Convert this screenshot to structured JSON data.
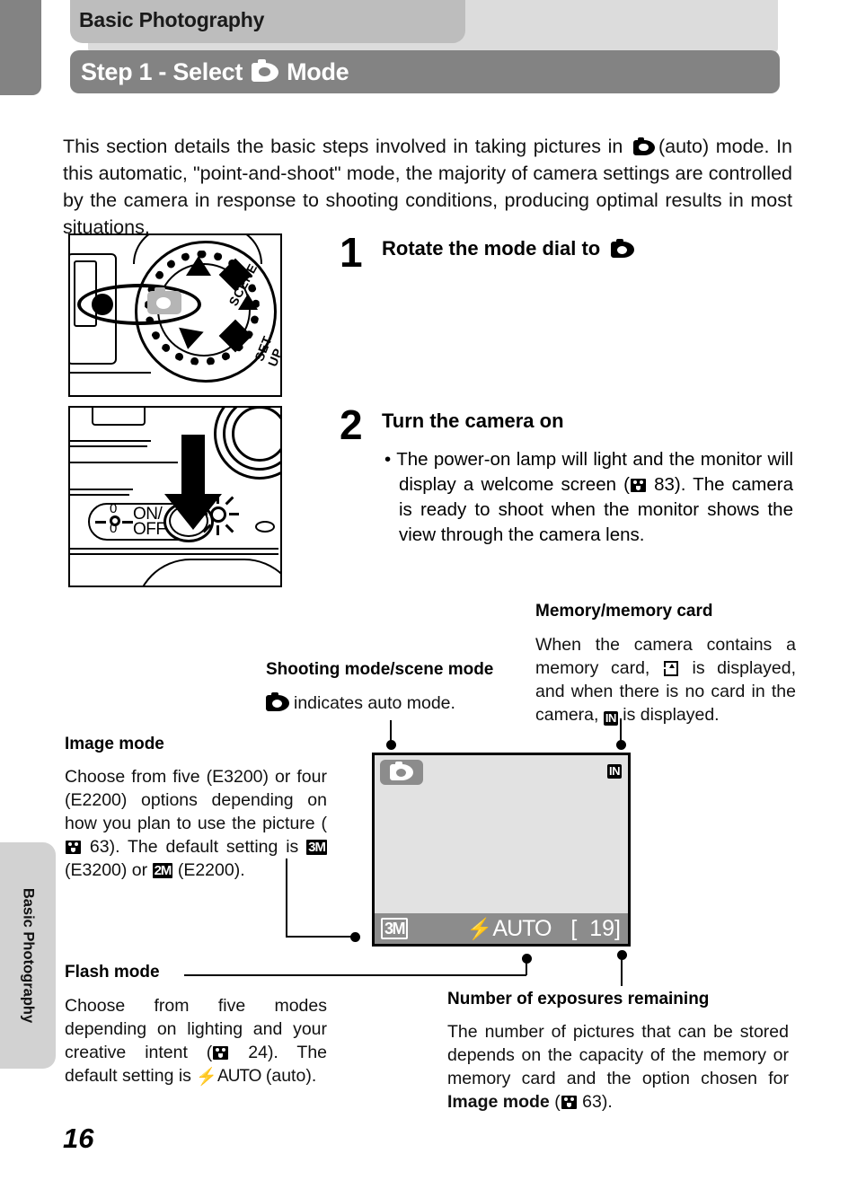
{
  "header": {
    "chapter_tab": "Basic Photography",
    "step_title_before": "Step 1 - Select",
    "step_title_after": "Mode",
    "auto_mode_icon": "camera-auto-icon"
  },
  "intro": {
    "part1": "This section details the basic steps involved in taking pictures in",
    "part2": "(auto) mode. In this automatic, \"point-and-shoot\" mode, the majority of camera settings are controlled by the camera in response to shooting conditions, producing optimal results in most situations."
  },
  "steps": [
    {
      "number": "1",
      "title_before": "Rotate the mode dial to",
      "title_after": "",
      "body": ""
    },
    {
      "number": "2",
      "title_before": "Turn the camera on",
      "title_after": "",
      "body_a": "The power-on lamp will light and the monitor will display a welcome screen (",
      "body_ref": "83",
      "body_b": "). The camera is ready to shoot when the monitor shows the view through the camera lens."
    }
  ],
  "illustrations": {
    "mode_dial": {
      "name": "mode-dial-illustration",
      "scene_label": "SCENE",
      "setup_label": "SET UP"
    },
    "power_switch": {
      "name": "power-switch-illustration",
      "on_label": "ON/",
      "off_label": "OFF"
    }
  },
  "callouts": {
    "memory": {
      "heading": "Memory/memory card",
      "text_a": "When the camera contains a memory card,",
      "text_b": "is displayed, and when there is no card in the camera,",
      "text_c": "is displayed.",
      "card_icon": "memory-card-icon",
      "internal_icon": "IN"
    },
    "shooting_mode": {
      "heading": "Shooting mode/scene mode",
      "text": "indicates auto mode."
    },
    "image_mode": {
      "heading": "Image mode",
      "text_a": "Choose from five (E3200) or four (E2200) options depending on how you plan to use the picture (",
      "ref": "63",
      "text_b": "). The default setting is",
      "tag_3m": "3M",
      "text_c": "(E3200) or",
      "tag_2m": "2M",
      "text_d": "(E2200)."
    },
    "flash_mode": {
      "heading": "Flash mode",
      "text_a": "Choose from five modes depending on lighting and your creative intent (",
      "ref": "24",
      "text_b": "). The default setting is",
      "flash_auto": "AUTO",
      "text_c": "(auto)."
    },
    "exposures": {
      "heading": "Number of exposures remaining",
      "text_a": "The number of pictures that can be stored depends on the capacity of the memory or memory card and the option chosen for",
      "bold": "Image mode",
      "text_b": "(",
      "ref": "63",
      "text_c": ")."
    }
  },
  "lcd": {
    "name": "camera-lcd-monitor",
    "mode_icon": "camera-auto-icon",
    "memory_indicator": "IN",
    "image_mode": "3M",
    "flash_mode": "AUTO",
    "exposures_remaining": "[  19]"
  },
  "sidebar": {
    "tab_label": "Basic Photography"
  },
  "folio": {
    "page_number": "16"
  },
  "colors": {
    "header_band": "#dcdcdc",
    "chapter_tab": "#bdbdbd",
    "step_title_bar": "#838383",
    "side_tab": "#d2d2d2",
    "lcd_screen": "#e2e2e2",
    "lcd_overlay": "#8c8c8c"
  }
}
